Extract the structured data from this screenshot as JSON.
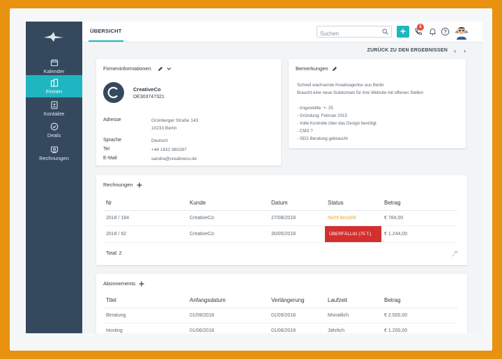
{
  "sidebar": {
    "logo_icon": "brand-logo-icon",
    "items": [
      {
        "label": "Kalender",
        "icon": "calendar-icon"
      },
      {
        "label": "Firmen",
        "icon": "building-icon",
        "active": true
      },
      {
        "label": "Kontakte",
        "icon": "contacts-icon"
      },
      {
        "label": "Deals",
        "icon": "check-circle-icon"
      },
      {
        "label": "Rechnungen",
        "icon": "invoice-icon"
      }
    ]
  },
  "header": {
    "tab": "ÜBERSICHT",
    "search_placeholder": "Suchen",
    "notification_count": "5",
    "back_link": "ZURÜCK ZU DEN ERGEBNISSEN",
    "prev_arrow": "‹",
    "next_arrow": "›"
  },
  "company_card": {
    "title": "Firmeninformationen",
    "name": "CreativeCo",
    "id": "DE303747321",
    "address_label": "Adresse",
    "address_line1": "Grünberger Straße 143",
    "address_line2": "10233 Berlin",
    "language_label": "Sprache",
    "language": "Deutsch",
    "phone_label": "Tel",
    "phone": "+44 1632 960287",
    "email_label": "E-Mail",
    "email": "sandra@creativeco.de"
  },
  "remarks_card": {
    "title": "Bemerkungen",
    "lines": [
      "Schnell wachsende Kreativagentur aus Berlin",
      "Braucht eine neue Subdomain für ihre Website mit offenen Stellen",
      "",
      "- Angestellte: +- 25",
      "- Gründung: Februar 2015",
      "- Volle Kontrolle über das Design benötigt",
      "- CMS ?",
      "- SEO Beratung gebraucht"
    ]
  },
  "invoices": {
    "title": "Rechnungen",
    "columns": [
      "Nr",
      "Kunde",
      "Datum",
      "Status",
      "Betrag"
    ],
    "rows": [
      {
        "nr": "2018 / 184",
        "kunde": "CreativeCo",
        "datum": "27/08/2018",
        "status": "Nicht bezahlt",
        "betrag": "€ 784,00"
      },
      {
        "nr": "2018 / 92",
        "kunde": "CreativeCo",
        "datum": "30/05/2018",
        "status": "ÜBERFÄLLIG (75 T.)",
        "betrag": "€ 1.244,00"
      }
    ],
    "total": "Total: 2"
  },
  "subscriptions": {
    "title": "Abonnements",
    "columns": [
      "Titel",
      "Anfangsdatum",
      "Verlängerung",
      "Laufzeit",
      "Betrag"
    ],
    "rows": [
      {
        "titel": "Beratung",
        "start": "01/09/2018",
        "renewal": "01/09/2018",
        "term": "Monatlich",
        "betrag": "€ 2.500,00"
      },
      {
        "titel": "Hosting",
        "start": "01/06/2018",
        "renewal": "01/06/2019",
        "term": "Jährlich",
        "betrag": "€ 1.200,00"
      }
    ]
  },
  "colors": {
    "sidebar": "#34495e",
    "accent": "#1fb6c1",
    "overdue": "#d32f2f",
    "warning": "#e8a434",
    "frame": "#e8920f"
  }
}
